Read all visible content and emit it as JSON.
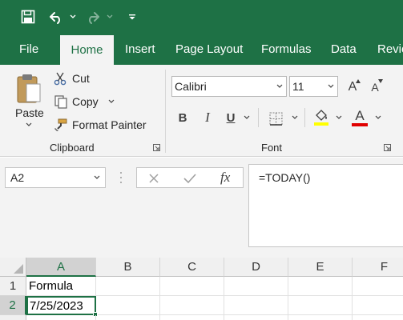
{
  "qat": {
    "save_icon": "save-icon",
    "undo_icon": "undo-icon",
    "redo_icon": "redo-icon",
    "customize_icon": "customize-qat-icon"
  },
  "tabs": [
    {
      "label": "File"
    },
    {
      "label": "Home",
      "active": true
    },
    {
      "label": "Insert"
    },
    {
      "label": "Page Layout"
    },
    {
      "label": "Formulas"
    },
    {
      "label": "Data"
    },
    {
      "label": "Revie"
    }
  ],
  "clipboard": {
    "paste_label": "Paste",
    "cut_label": "Cut",
    "copy_label": "Copy",
    "format_painter_label": "Format Painter",
    "group_label": "Clipboard"
  },
  "font": {
    "font_name": "Calibri",
    "font_size": "11",
    "bold_label": "B",
    "italic_label": "I",
    "underline_label": "U",
    "increase_label": "A",
    "decrease_label": "A",
    "font_color_label": "A",
    "group_label": "Font",
    "highlight_color": "#ffff00",
    "font_color": "#e00000"
  },
  "formula_bar": {
    "name_box": "A2",
    "fx_label": "fx",
    "formula": "=TODAY()"
  },
  "grid": {
    "columns": [
      "A",
      "B",
      "C",
      "D",
      "E",
      "F"
    ],
    "rows": [
      "1",
      "2"
    ],
    "cells": {
      "A1": "Formula",
      "A2": "7/25/2023"
    },
    "selected_cell": "A2"
  },
  "colors": {
    "accent": "#1e7145"
  }
}
